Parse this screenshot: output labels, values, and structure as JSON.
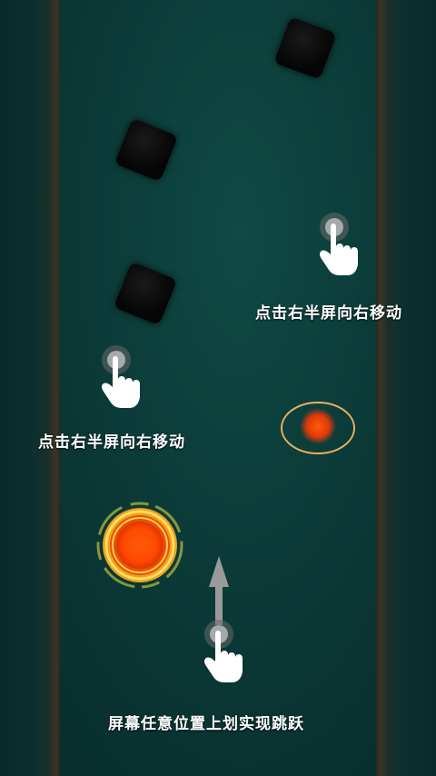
{
  "hints": {
    "tap_right_top": "点击右半屏向右移动",
    "tap_right_left": "点击右半屏向右移动",
    "swipe_up": "屏幕任意位置上划实现跳跃"
  },
  "colors": {
    "background": "#0b3a37",
    "ball": "#ff5a0a",
    "ring": "#e8b060",
    "text": "#ffffff"
  },
  "icons": {
    "hand": "tap-hand-icon",
    "arrow": "arrow-up-icon"
  }
}
